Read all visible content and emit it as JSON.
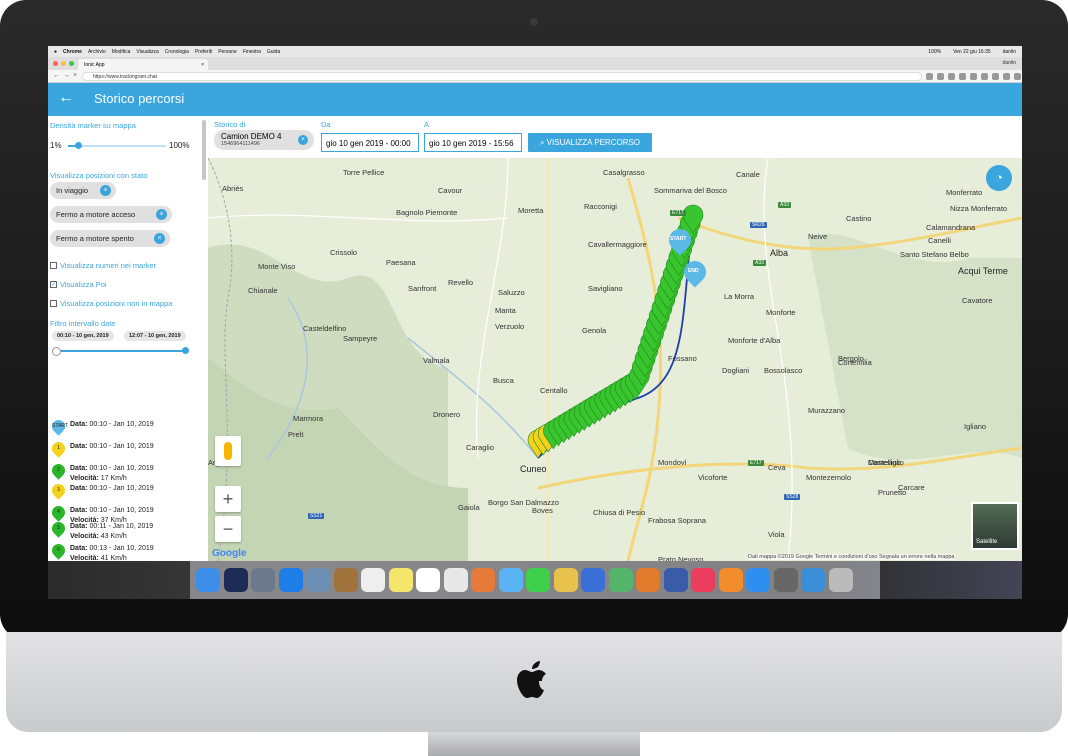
{
  "macmenu": {
    "app": "Chrome",
    "items": [
      "Archivio",
      "Modifica",
      "Visualizza",
      "Cronologia",
      "Preferiti",
      "Persone",
      "Finestra",
      "Guida"
    ],
    "battery": "100%",
    "clock": "Ven 22 giu 16:35",
    "user": "danilo"
  },
  "browser": {
    "tab_title": "Ionic App",
    "url": "https://www.trackingram.chat"
  },
  "header": {
    "back_icon": "arrow-left-icon",
    "title": "Storico percorsi"
  },
  "sidebar": {
    "density_label": "Densità marker su mappa",
    "density_min": "1%",
    "density_max": "100%",
    "density_value": 0.1,
    "status_label": "Visualizza posizioni con stato",
    "status_chips": [
      "In viaggio",
      "Fermo a motore acceso",
      "Fermo a motore spento"
    ],
    "checkboxes": [
      {
        "label": "Visualizza numeri nei marker",
        "checked": false
      },
      {
        "label": "Visualizza Poi",
        "checked": true
      },
      {
        "label": "Visualizza posizioni non in mappa",
        "checked": false
      }
    ],
    "interval_label": "Filtro intervallo date",
    "interval_start": "00:10 - 10 gen, 2019",
    "interval_end": "12:07 - 10 gen, 2019",
    "positions": [
      {
        "pin": "START",
        "color": "#5bb9e8",
        "date_label": "Data:",
        "date": "00:10 - Jan 10, 2019",
        "speed_label": "",
        "speed": ""
      },
      {
        "pin": "1",
        "color": "#f4d21b",
        "date_label": "Data:",
        "date": "00:10 - Jan 10, 2019",
        "speed_label": "",
        "speed": ""
      },
      {
        "pin": "2",
        "color": "#2bb52b",
        "date_label": "Data:",
        "date": "00:10 - Jan 10, 2019",
        "speed_label": "Velocità:",
        "speed": "17 Km/h"
      },
      {
        "pin": "3",
        "color": "#f4d21b",
        "date_label": "Data:",
        "date": "00:10 - Jan 10, 2019",
        "speed_label": "",
        "speed": ""
      },
      {
        "pin": "4",
        "color": "#2bb52b",
        "date_label": "Data:",
        "date": "00:10 - Jan 10, 2019",
        "speed_label": "Velocità:",
        "speed": "37 Km/h"
      },
      {
        "pin": "5",
        "color": "#2bb52b",
        "date_label": "Data:",
        "date": "00:11 - Jan 10, 2019",
        "speed_label": "Velocità:",
        "speed": "43 Km/h"
      },
      {
        "pin": "6",
        "color": "#2bb52b",
        "date_label": "Data:",
        "date": "00:13 - Jan 10, 2019",
        "speed_label": "Velocità:",
        "speed": "41 Km/h"
      },
      {
        "pin": "7",
        "color": "#2bb52b",
        "date_label": "Data:",
        "date": "00:14 - Jan 10, 2019",
        "speed_label": "Velocità:",
        "speed": "42 Km/h"
      },
      {
        "pin": "8",
        "color": "#f4d21b",
        "date_label": "Data:",
        "date": "00:15 - Jan 10, 2019",
        "speed_label": "",
        "speed": ""
      }
    ]
  },
  "filters": {
    "vehicle_label": "Storico di",
    "vehicle_name": "Camion DEMO 4",
    "vehicle_id": "1546964111496",
    "from_label": "Da",
    "from_value": "gio 10 gen 2019 - 00:00",
    "to_label": "A",
    "to_value": "gio 10 gen 2019 - 15:56",
    "show_button": "VISUALIZZA PERCORSO"
  },
  "map": {
    "towns": [
      "Casalgrasso",
      "Canale",
      "Cavour",
      "Torre Pellice",
      "Abriès",
      "Sommariva del Bosco",
      "Moretta",
      "Racconigi",
      "Bagnolo Piemonte",
      "Cavallermaggiore",
      "Alba",
      "Neive",
      "Castino",
      "Monforte",
      "Crissolo",
      "Paesana",
      "Revello",
      "Saluzzo",
      "Savigliano",
      "Sanfront",
      "La Morra",
      "Monforte d'Alba",
      "Chianale",
      "Manta",
      "Verzuolo",
      "Genola",
      "Bossolasco",
      "Casteldelfino",
      "Sampeyre",
      "Fossano",
      "Dogliani",
      "Valmala",
      "Busca",
      "Centallo",
      "Marmora",
      "Dronero",
      "Prelt",
      "Caraglio",
      "Cuneo",
      "Mondovì",
      "Vicoforte",
      "Ceva",
      "Montezemolo",
      "Castellino",
      "Borgo San Dalmazzo",
      "Boves",
      "Chiusa di Pesio",
      "Frabosa Soprana",
      "Viola",
      "Gaiola",
      "Cortemilia",
      "Bergolo",
      "Murazzano",
      "Igliano",
      "Prunetto",
      "Carcare",
      "Monesiglio",
      "Calamandrana",
      "Acqui Terme",
      "Canelli",
      "Cavatore",
      "Santo Stefano Belbo",
      "Nizza Monferrato",
      "Monferrato",
      "Prato Nevoso",
      "Monte Viso",
      "Argentera"
    ],
    "road_labels": [
      "E717",
      "SR29",
      "A33",
      "A33",
      "E717",
      "SS28",
      "SS21"
    ],
    "start_label": "START",
    "end_label": "END",
    "satellite_label": "Satellite",
    "zoom_in": "+",
    "zoom_out": "−",
    "footer": "Dati mappa ©2019 Google   Termini e condizioni d'uso   Segnala un errore nella mappa",
    "google_logo": "Google",
    "route_color": "#1f3fb0",
    "marker_color": "#39c52d"
  }
}
